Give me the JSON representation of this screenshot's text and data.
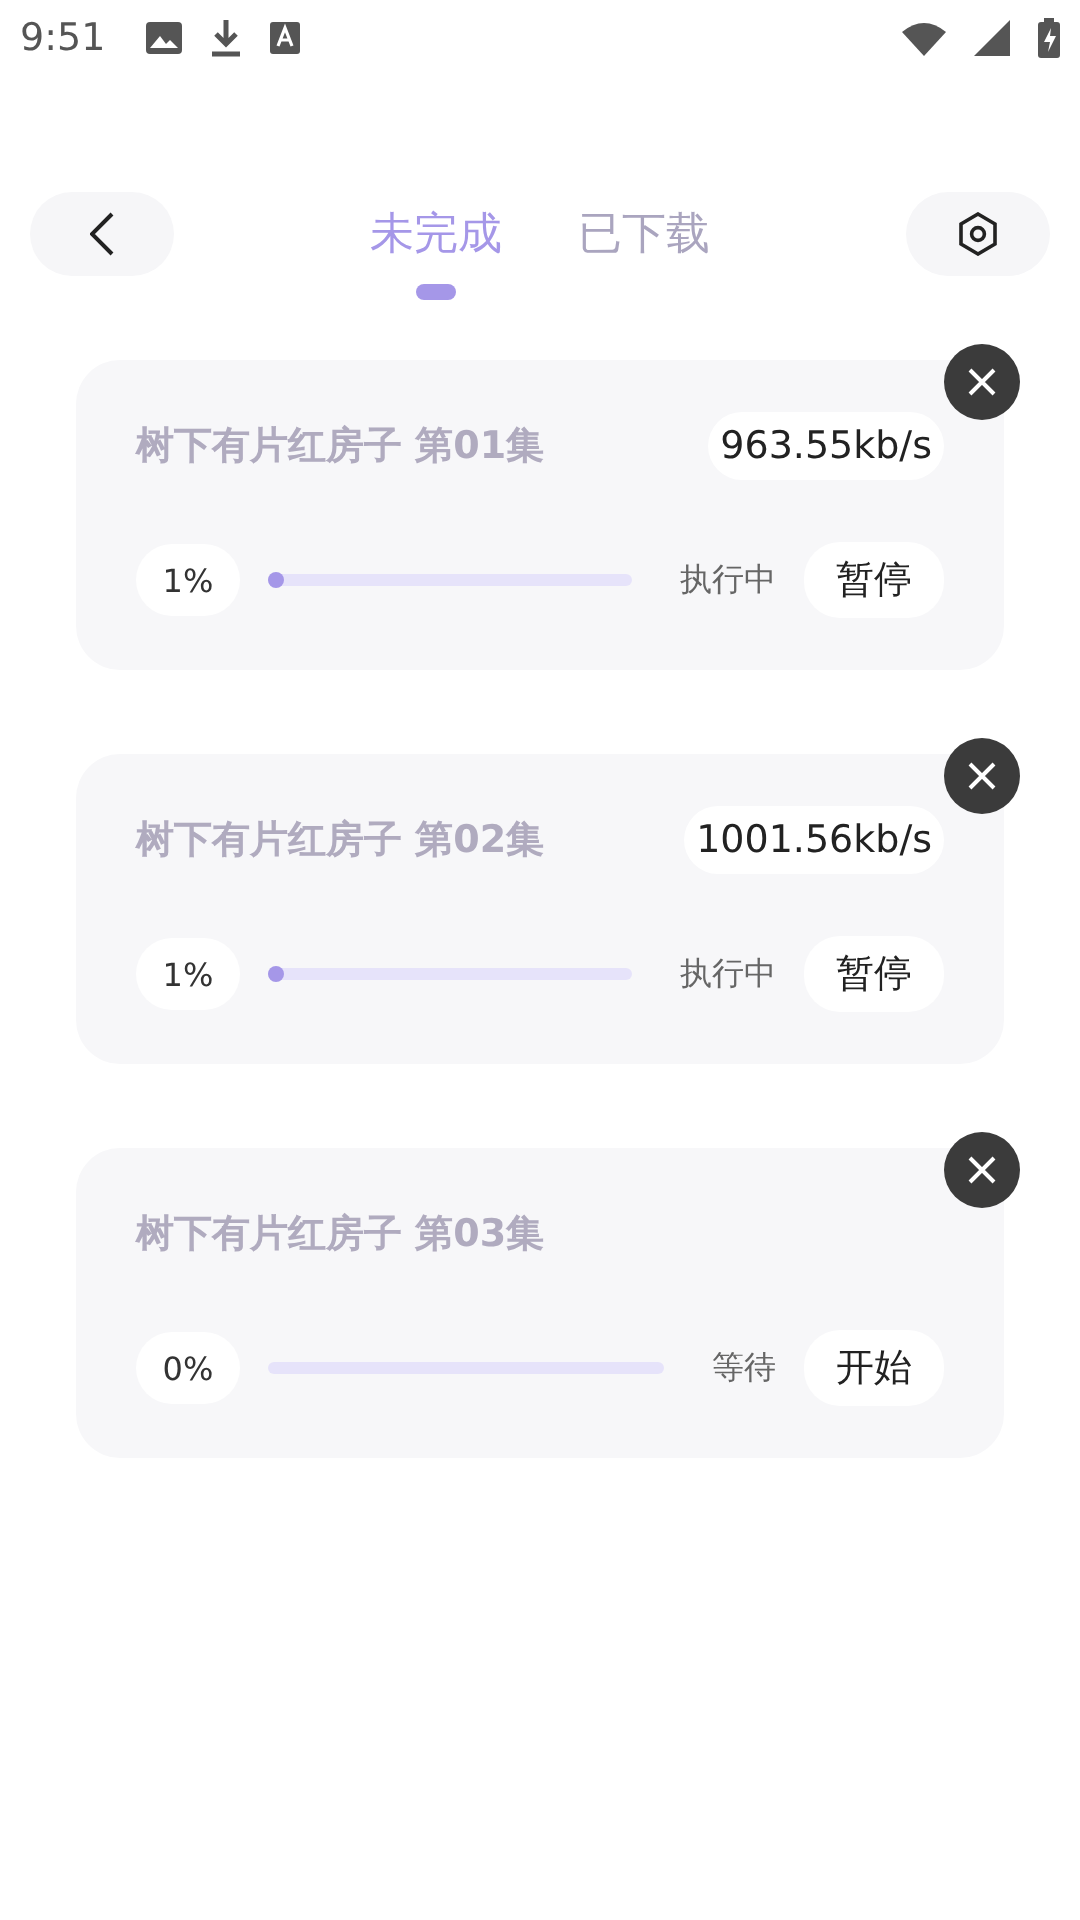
{
  "status_bar": {
    "time": "9:51"
  },
  "tabs": [
    {
      "label": "未完成",
      "selected": true
    },
    {
      "label": "已下载",
      "selected": false
    }
  ],
  "downloads": [
    {
      "title": "树下有片红房子 第01集",
      "speed": "963.55kb/s",
      "percent": "1%",
      "level": 0.01,
      "status": "执行中",
      "action": "暂停"
    },
    {
      "title": "树下有片红房子 第02集",
      "speed": "1001.56kb/s",
      "percent": "1%",
      "level": 0.01,
      "status": "执行中",
      "action": "暂停"
    },
    {
      "title": "树下有片红房子 第03集",
      "percent": "0%",
      "status": "等待",
      "action": "开始"
    }
  ]
}
